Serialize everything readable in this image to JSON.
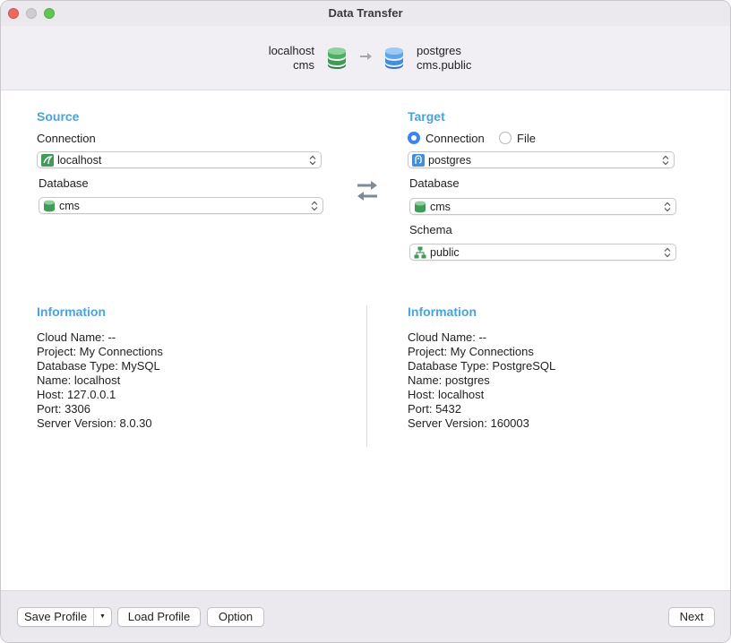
{
  "window": {
    "title": "Data Transfer"
  },
  "header": {
    "source_host": "localhost",
    "source_db": "cms",
    "target_host": "postgres",
    "target_db": "cms.public"
  },
  "source": {
    "heading": "Source",
    "connection_label": "Connection",
    "connection_value": "localhost",
    "database_label": "Database",
    "database_value": "cms"
  },
  "target": {
    "heading": "Target",
    "radio_connection_label": "Connection",
    "radio_file_label": "File",
    "selected_mode": "Connection",
    "connection_value": "postgres",
    "database_label": "Database",
    "database_value": "cms",
    "schema_label": "Schema",
    "schema_value": "public"
  },
  "source_info": {
    "heading": "Information",
    "lines": [
      "Cloud Name: --",
      "Project: My Connections",
      "Database Type: MySQL",
      "Name: localhost",
      "Host: 127.0.0.1",
      "Port: 3306",
      "Server Version: 8.0.30"
    ]
  },
  "target_info": {
    "heading": "Information",
    "lines": [
      "Cloud Name: --",
      "Project: My Connections",
      "Database Type: PostgreSQL",
      "Name: postgres",
      "Host: localhost",
      "Port: 5432",
      "Server Version: 160003"
    ]
  },
  "footer": {
    "save_profile": "Save Profile",
    "load_profile": "Load Profile",
    "option": "Option",
    "next": "Next"
  },
  "colors": {
    "accent": "#4da3d6",
    "mysql_green": "#3f9b57",
    "postgres_blue": "#3f8fe0",
    "radio_blue": "#3b82f6"
  },
  "icons": {
    "source_db": "green-database-icon",
    "target_db": "blue-database-icon",
    "mysql_conn": "mysql-connection-icon",
    "pg_conn": "postgres-connection-icon",
    "schema": "schema-icon",
    "swap": "swap-arrows-icon"
  }
}
